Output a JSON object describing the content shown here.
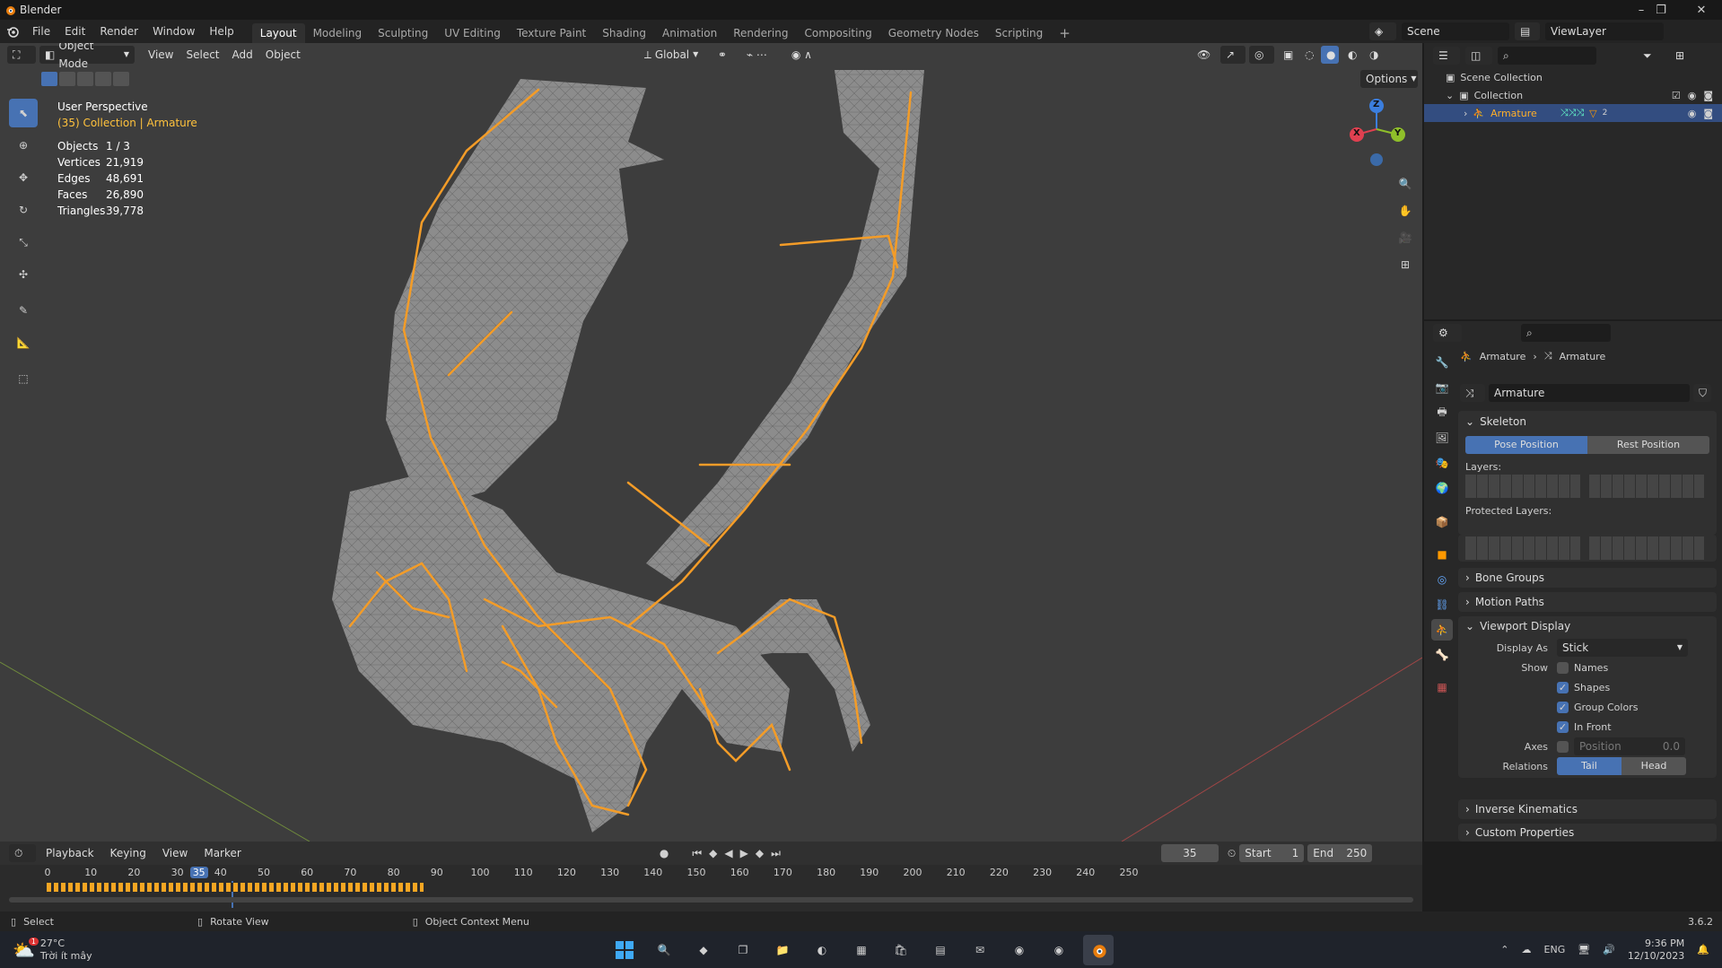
{
  "app": {
    "title": "Blender",
    "version": "3.6.2"
  },
  "menus": [
    "File",
    "Edit",
    "Render",
    "Window",
    "Help"
  ],
  "workspaces": [
    {
      "label": "Layout",
      "active": true
    },
    {
      "label": "Modeling"
    },
    {
      "label": "Sculpting"
    },
    {
      "label": "UV Editing"
    },
    {
      "label": "Texture Paint"
    },
    {
      "label": "Shading"
    },
    {
      "label": "Animation"
    },
    {
      "label": "Rendering"
    },
    {
      "label": "Compositing"
    },
    {
      "label": "Geometry Nodes"
    },
    {
      "label": "Scripting"
    }
  ],
  "scene": {
    "name": "Scene",
    "view_layer": "ViewLayer"
  },
  "viewport": {
    "mode": "Object Mode",
    "menus": [
      "View",
      "Select",
      "Add",
      "Object"
    ],
    "transform_orientation": "Global",
    "options_label": "Options",
    "perspective": "User Perspective",
    "context": "(35) Collection | Armature",
    "stats": [
      {
        "label": "Objects",
        "value": "1 / 3"
      },
      {
        "label": "Vertices",
        "value": "21,919"
      },
      {
        "label": "Edges",
        "value": "48,691"
      },
      {
        "label": "Faces",
        "value": "26,890"
      },
      {
        "label": "Triangles",
        "value": "39,778"
      }
    ],
    "gizmo": {
      "x": "X",
      "y": "Y",
      "z": "Z"
    }
  },
  "outliner": {
    "root": "Scene Collection",
    "collection": "Collection",
    "object": "Armature",
    "object_sub": "2"
  },
  "properties": {
    "breadcrumb": [
      "Armature",
      "Armature"
    ],
    "data_name": "Armature",
    "skeleton": {
      "title": "Skeleton",
      "pose_position": "Pose Position",
      "rest_position": "Rest Position",
      "layers_label": "Layers:",
      "protected_label": "Protected Layers:"
    },
    "collapsed_panels": [
      "Bone Groups",
      "Motion Paths"
    ],
    "viewport_display": {
      "title": "Viewport Display",
      "display_as_label": "Display As",
      "display_as_value": "Stick",
      "show_label": "Show",
      "names": "Names",
      "shapes": "Shapes",
      "group_colors": "Group Colors",
      "in_front": "In Front",
      "axes_label": "Axes",
      "position_label": "Position",
      "position_value": "0.0",
      "relations_label": "Relations",
      "tail": "Tail",
      "head": "Head"
    },
    "bottom_panels": [
      "Inverse Kinematics",
      "Custom Properties"
    ]
  },
  "timeline": {
    "menus": [
      "Playback",
      "Keying",
      "View",
      "Marker"
    ],
    "current_frame": "35",
    "start_label": "Start",
    "start": "1",
    "end_label": "End",
    "end": "250",
    "ticks": [
      "0",
      "10",
      "20",
      "30",
      "35",
      "40",
      "50",
      "60",
      "70",
      "80",
      "90",
      "100",
      "110",
      "120",
      "130",
      "140",
      "150",
      "160",
      "170",
      "180",
      "190",
      "200",
      "210",
      "220",
      "230",
      "240",
      "250"
    ]
  },
  "statusbar": {
    "select": "Select",
    "rotate": "Rotate View",
    "context_menu": "Object Context Menu",
    "version": "3.6.2"
  },
  "taskbar": {
    "weather_temp": "27°C",
    "weather_text": "Trời ít mây",
    "weather_badge": "1",
    "lang": "ENG",
    "time": "9:36 PM",
    "date": "12/10/2023"
  },
  "colors": {
    "accent": "#4772b3",
    "bone": "#f39c28",
    "active_object": "#ffaf29",
    "axis_x": "#e04050",
    "axis_y": "#8fbf2a",
    "axis_z": "#3b7ede"
  }
}
